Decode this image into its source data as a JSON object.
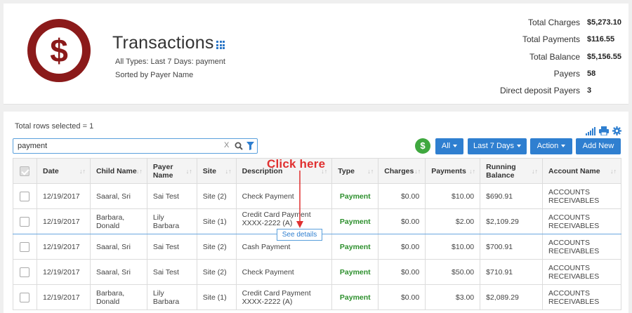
{
  "header": {
    "title": "Transactions",
    "subtitle1": "All Types: Last 7 Days: payment",
    "subtitle2": "Sorted by Payer Name",
    "logo_icon": "dollar-circle-icon",
    "accent": "#8b1a1a"
  },
  "summary": [
    {
      "label": "Total Charges",
      "value": "$5,273.10"
    },
    {
      "label": "Total Payments",
      "value": "$116.55"
    },
    {
      "label": "Total Balance",
      "value": "$5,156.55"
    },
    {
      "label": "Payers",
      "value": "58"
    },
    {
      "label": "Direct deposit Payers",
      "value": "3"
    }
  ],
  "toolbar": {
    "rows_selected": "Total rows selected = 1",
    "search_value": "payment",
    "clear_label": "X",
    "dollar_label": "$",
    "all_label": "All",
    "days_label": "Last 7 Days",
    "action_label": "Action",
    "add_label": "Add New",
    "primary_color": "#2f7fd0"
  },
  "table": {
    "columns": [
      "Date",
      "Child Name",
      "Payer Name",
      "Site",
      "Description",
      "Type",
      "Charges",
      "Payments",
      "Running Balance",
      "Account Name"
    ],
    "rows": [
      {
        "date": "12/19/2017",
        "child": "Saaral, Sri",
        "payer": "Sai Test",
        "site": "Site (2)",
        "description": "Check Payment",
        "type": "Payment",
        "charges": "$0.00",
        "payments": "$10.00",
        "balance": "$690.91",
        "account": "ACCOUNTS RECEIVABLES"
      },
      {
        "date": "12/19/2017",
        "child": "Barbara, Donald",
        "payer": "Lily Barbara",
        "site": "Site (1)",
        "description": "Credit Card Payment XXXX-2222 (A)",
        "type": "Payment",
        "charges": "$0.00",
        "payments": "$2.00",
        "balance": "$2,109.29",
        "account": "ACCOUNTS RECEIVABLES"
      },
      {
        "date": "12/19/2017",
        "child": "Saaral, Sri",
        "payer": "Sai Test",
        "site": "Site (2)",
        "description": "Cash Payment",
        "type": "Payment",
        "charges": "$0.00",
        "payments": "$10.00",
        "balance": "$700.91",
        "account": "ACCOUNTS RECEIVABLES"
      },
      {
        "date": "12/19/2017",
        "child": "Saaral, Sri",
        "payer": "Sai Test",
        "site": "Site (2)",
        "description": "Check Payment",
        "type": "Payment",
        "charges": "$0.00",
        "payments": "$50.00",
        "balance": "$710.91",
        "account": "ACCOUNTS RECEIVABLES"
      },
      {
        "date": "12/19/2017",
        "child": "Barbara, Donald",
        "payer": "Lily Barbara",
        "site": "Site (1)",
        "description": "Credit Card Payment XXXX-2222 (A)",
        "type": "Payment",
        "charges": "$0.00",
        "payments": "$3.00",
        "balance": "$2,089.29",
        "account": "ACCOUNTS RECEIVABLES"
      }
    ]
  },
  "annotation": {
    "callout": "Click here",
    "see_details": "See details",
    "callout_color": "#e03030"
  }
}
